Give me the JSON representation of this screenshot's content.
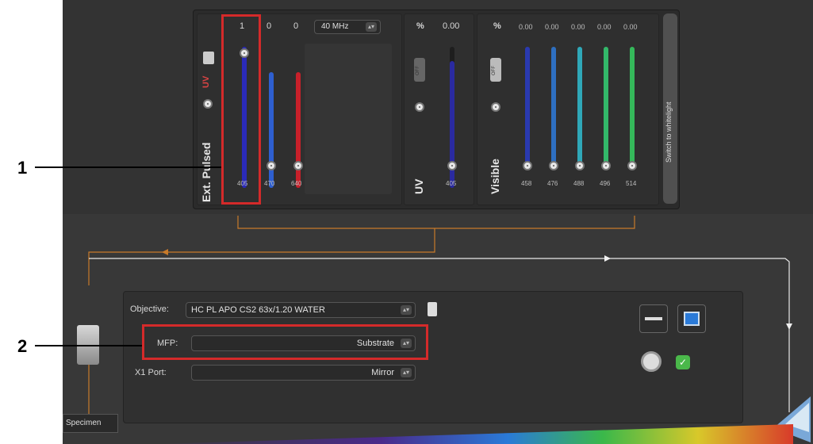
{
  "laser_panel": {
    "ext_pulsed": {
      "label": "Ext. Pulsed",
      "uv_label": "UV",
      "frequency": "40 MHz",
      "lines": [
        {
          "intensity": "1",
          "wavelength": "405",
          "color": "#2a2ab8",
          "fill": 1.0
        },
        {
          "intensity": "0",
          "wavelength": "470",
          "color": "#2e5fd0",
          "fill": 0.82
        },
        {
          "intensity": "0",
          "wavelength": "640",
          "color": "#c8202a",
          "fill": 0.82
        }
      ]
    },
    "uv": {
      "label": "UV",
      "unit": "%",
      "value": "0.00",
      "toggle_label": "OFF",
      "wavelength": "405",
      "slider_color": "#2a2aa0",
      "fill": 0.9
    },
    "visible": {
      "label": "Visible",
      "unit": "%",
      "toggle_label": "OFF",
      "lines": [
        {
          "intensity": "0.00",
          "wavelength": "458",
          "color": "#2a3ab0"
        },
        {
          "intensity": "0.00",
          "wavelength": "476",
          "color": "#2e6fc0"
        },
        {
          "intensity": "0.00",
          "wavelength": "488",
          "color": "#2fa8b8"
        },
        {
          "intensity": "0.00",
          "wavelength": "496",
          "color": "#33b86a"
        },
        {
          "intensity": "0.00",
          "wavelength": "514",
          "color": "#35b85a"
        }
      ]
    },
    "switch_button": "Switch to whitelight"
  },
  "beam_path": {
    "objective_label": "Objective:",
    "objective_value": "HC PL APO CS2  63x/1.20 WATER",
    "mfp_label": "MFP:",
    "mfp_value": "Substrate",
    "x1_label": "X1 Port:",
    "x1_value": "Mirror",
    "specimen_label": "Specimen"
  },
  "callouts": {
    "one": "1",
    "two": "2"
  },
  "colors": {
    "highlight": "#d42a2a",
    "beam": "#c87a2a"
  }
}
